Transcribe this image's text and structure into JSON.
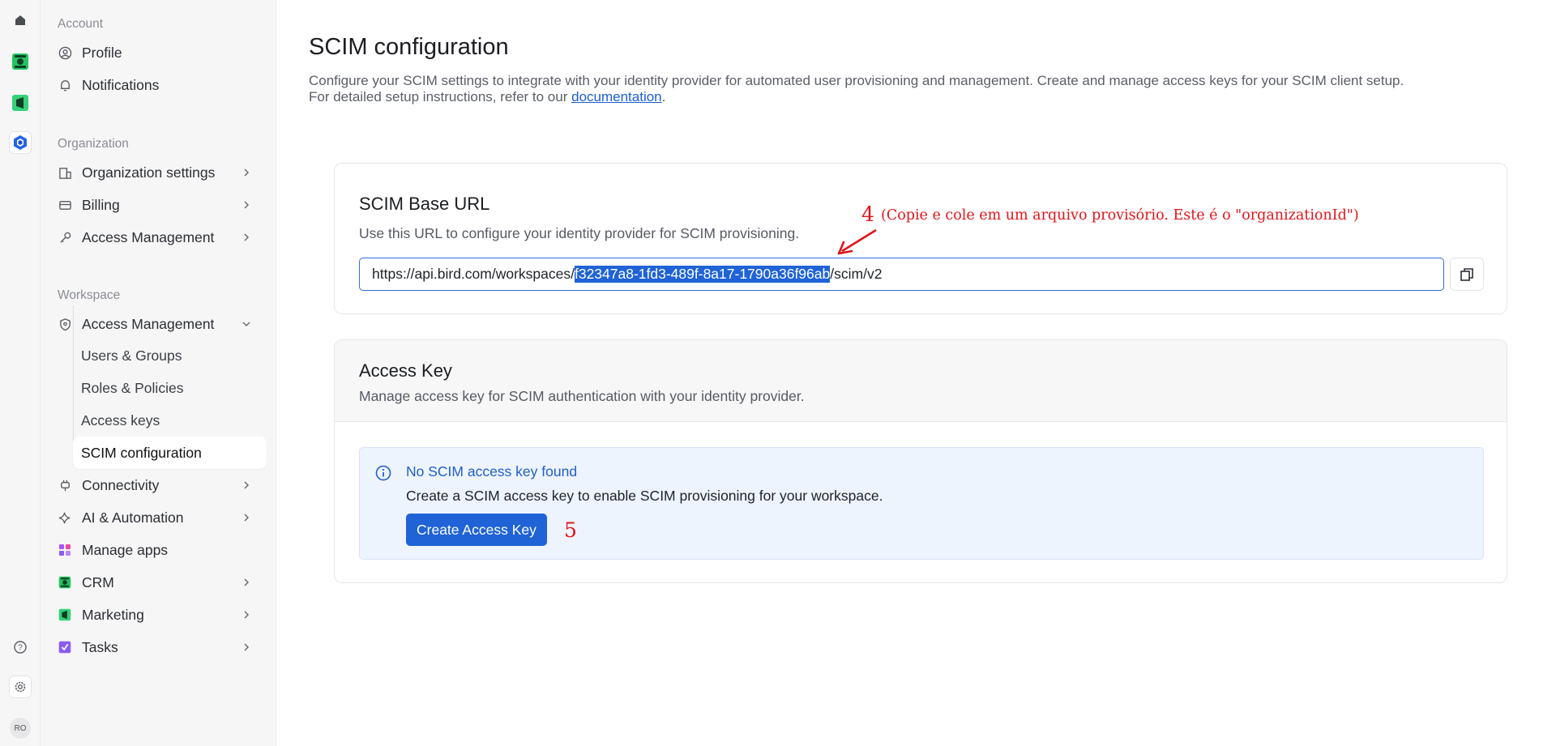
{
  "rail": {
    "items": [
      {
        "name": "home-icon"
      },
      {
        "name": "crm-app-icon"
      },
      {
        "name": "marketing-app-icon"
      },
      {
        "name": "bird-app-icon"
      }
    ],
    "bottom": [
      {
        "name": "help-icon"
      },
      {
        "name": "settings-icon"
      }
    ],
    "avatar_initials": "RO"
  },
  "sidebar": {
    "account": {
      "title": "Account",
      "items": [
        {
          "label": "Profile",
          "icon": "user-circle-icon"
        },
        {
          "label": "Notifications",
          "icon": "bell-icon"
        }
      ]
    },
    "organization": {
      "title": "Organization",
      "items": [
        {
          "label": "Organization settings",
          "icon": "building-icon"
        },
        {
          "label": "Billing",
          "icon": "credit-card-icon"
        },
        {
          "label": "Access Management",
          "icon": "key-icon"
        }
      ]
    },
    "workspace": {
      "title": "Workspace",
      "access_management": {
        "label": "Access Management",
        "icon": "shield-icon"
      },
      "sub_items": [
        {
          "label": "Users & Groups"
        },
        {
          "label": "Roles & Policies"
        },
        {
          "label": "Access keys"
        },
        {
          "label": "SCIM configuration"
        }
      ],
      "items": [
        {
          "label": "Connectivity",
          "icon": "plug-icon"
        },
        {
          "label": "AI & Automation",
          "icon": "sparkle-icon"
        },
        {
          "label": "Manage apps",
          "icon": "apps-grid-icon"
        },
        {
          "label": "CRM",
          "icon": "crm-app-icon"
        },
        {
          "label": "Marketing",
          "icon": "marketing-app-icon"
        },
        {
          "label": "Tasks",
          "icon": "tasks-app-icon"
        }
      ]
    }
  },
  "main": {
    "title": "SCIM configuration",
    "description_line1": "Configure your SCIM settings to integrate with your identity provider for automated user provisioning and management. Create and manage access keys for your SCIM client setup.",
    "description_line2_prefix": "For detailed setup instructions, refer to our ",
    "description_link": "documentation",
    "description_line2_suffix": ".",
    "base_url_card": {
      "title": "SCIM Base URL",
      "subtitle": "Use this URL to configure your identity provider for SCIM provisioning.",
      "url_prefix": "https://api.bird.com/workspaces/",
      "url_selected": "f32347a8-1fd3-489f-8a17-1790a36f96ab",
      "url_suffix": "/scim/v2"
    },
    "access_key_card": {
      "title": "Access Key",
      "subtitle": "Manage access key for SCIM authentication with your identity provider.",
      "info_title": "No SCIM access key found",
      "info_text": "Create a SCIM access key to enable SCIM provisioning for your workspace.",
      "button_label": "Create Access Key"
    }
  },
  "annotations": {
    "step4_number": "4",
    "step4_text": "(Copie e cole em um arquivo provisório. Este é o \"organizationId\")",
    "step5_number": "5",
    "color": "#e0141a"
  }
}
